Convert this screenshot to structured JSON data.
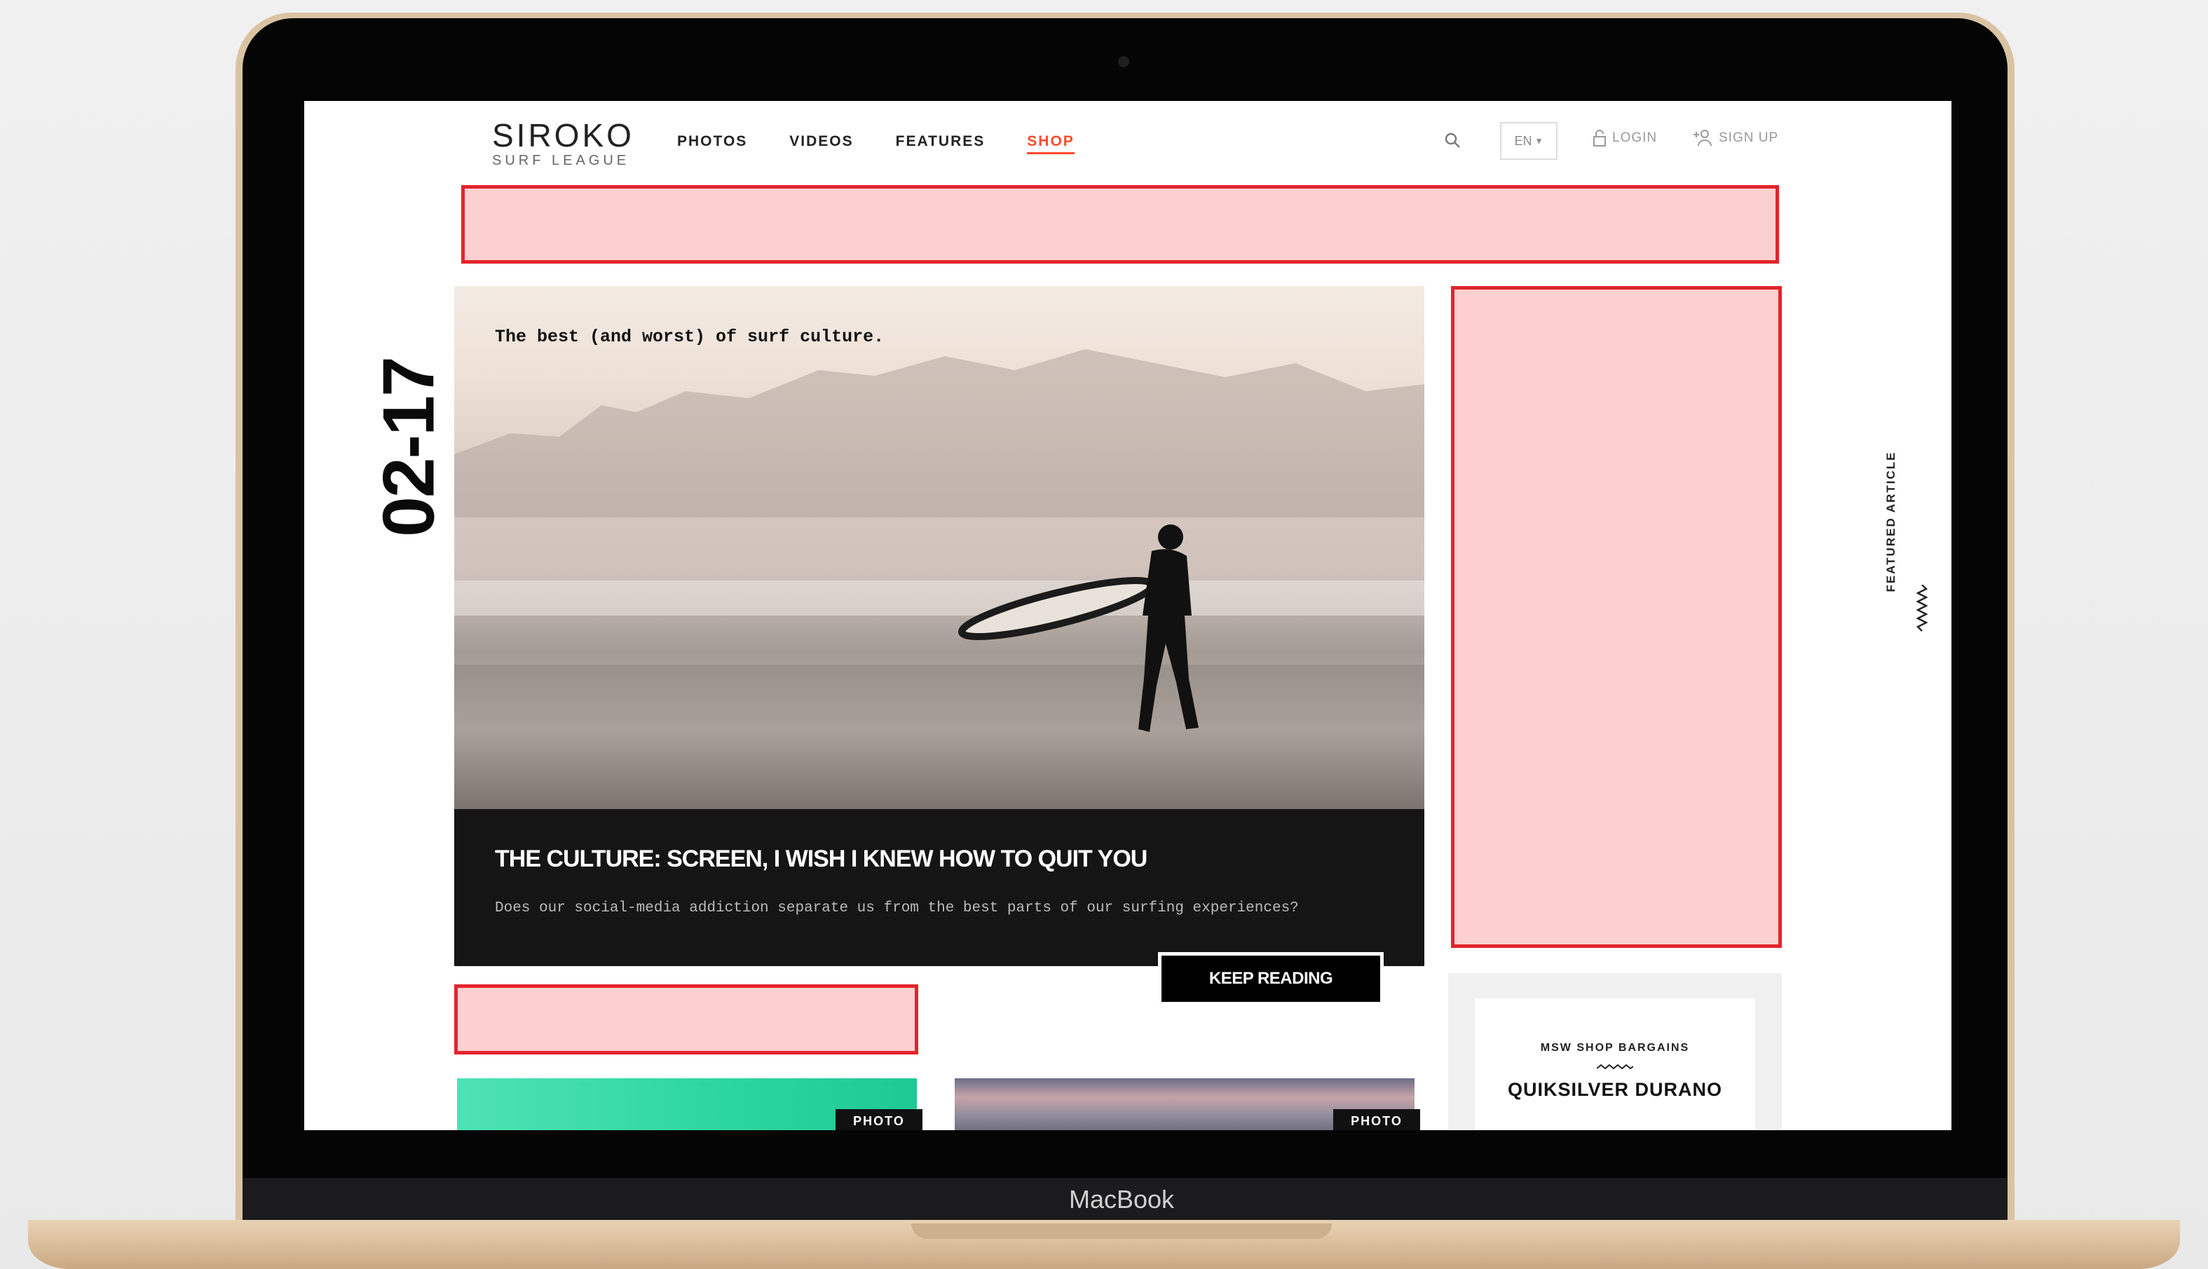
{
  "device": {
    "brand_label": "MacBook"
  },
  "header": {
    "logo_main": "SIROKO",
    "logo_sub": "SURF LEAGUE",
    "nav": [
      {
        "label": "PHOTOS",
        "active": false
      },
      {
        "label": "VIDEOS",
        "active": false
      },
      {
        "label": "FEATURES",
        "active": false
      },
      {
        "label": "SHOP",
        "active": true
      }
    ],
    "search_icon": "search-icon",
    "language": "EN",
    "login_label": "LOGIN",
    "signup_label": "SIGN UP"
  },
  "hero": {
    "caption": "The best (and worst) of surf culture.",
    "date": "02-17",
    "title": "THE CULTURE: SCREEN, I WISH I KNEW HOW TO QUIT YOU",
    "description": "Does our social-media addiction separate us from the best parts of our surfing experiences?",
    "cta": "KEEP READING"
  },
  "sidebar": {
    "featured_label": "FEATURED ARTICLE"
  },
  "shop_card": {
    "small_label": "MSW SHOP BARGAINS",
    "product_name": "QUIKSILVER DURANO"
  },
  "thumbnails": [
    {
      "tag": "PHOTO"
    },
    {
      "tag": "PHOTO"
    }
  ],
  "colors": {
    "accent": "#ff4a2e",
    "ad_border": "#e3242b",
    "ad_fill": "#fcd0d0",
    "dark": "#151515"
  }
}
